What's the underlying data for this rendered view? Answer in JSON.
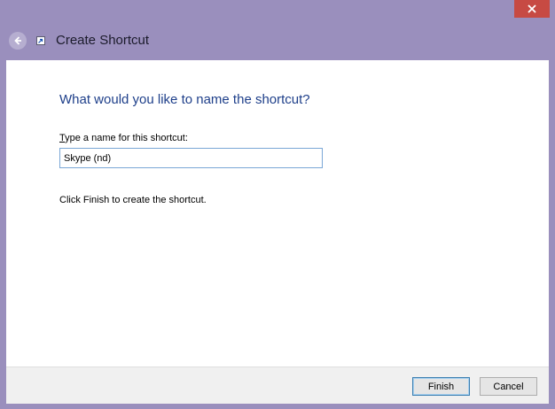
{
  "window": {
    "title": "Create Shortcut",
    "close_label": "Close"
  },
  "content": {
    "heading": "What would you like to name the shortcut?",
    "field_label_accel": "T",
    "field_label_rest": "ype a name for this shortcut:",
    "name_value": "Skype (nd)",
    "hint": "Click Finish to create the shortcut."
  },
  "footer": {
    "finish_label": "Finish",
    "cancel_label": "Cancel"
  },
  "icons": {
    "back": "back-arrow-icon",
    "shortcut": "shortcut-icon",
    "close": "close-icon"
  },
  "colors": {
    "frame": "#9a8fbd",
    "heading": "#1e3f8a",
    "close": "#c74a43"
  }
}
